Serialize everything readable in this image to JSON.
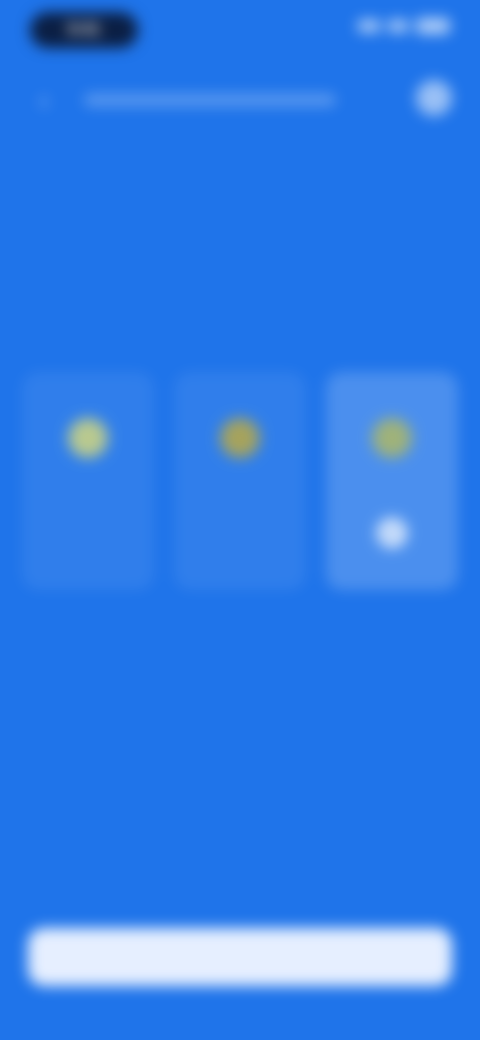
{
  "status_bar": {
    "time": "9:41",
    "icons": [
      "signal-icon",
      "wifi-icon",
      "battery-icon"
    ]
  },
  "header": {
    "back_icon": "chevron-left-icon",
    "title": "",
    "settings_icon": "settings-icon"
  },
  "main": {
    "headline": "",
    "description": "",
    "options": [
      {
        "label": "",
        "sub": "",
        "icon": "sun-icon",
        "icon_color": "#b9c98f",
        "selected": false
      },
      {
        "label": "",
        "sub": "",
        "icon": "sun-icon",
        "icon_color": "#a6a35d",
        "selected": false
      },
      {
        "label": "",
        "sub": "",
        "icon": "leaf-icon",
        "icon_color": "#9fb27a",
        "selected": true,
        "check_icon": "check-icon"
      }
    ],
    "link": ""
  },
  "footer": {
    "cta_label": ""
  },
  "colors": {
    "background": "#1f74ea",
    "cta_background": "#e6efff",
    "status_pill": "#0b1f44"
  }
}
